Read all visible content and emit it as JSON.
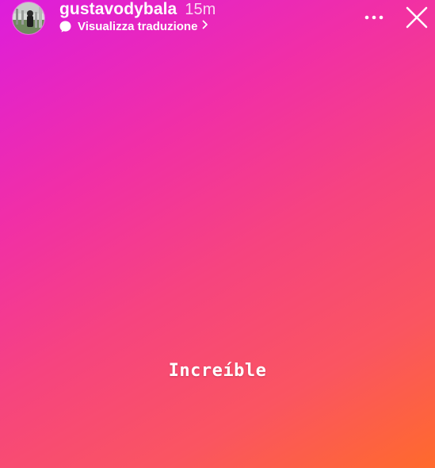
{
  "story": {
    "username": "gustavodybala",
    "time_ago": "15m",
    "translate_label": "Visualizza traduzione",
    "caption": "Increíble",
    "gradient_colors": [
      "#dd1ddc",
      "#f12fa6",
      "#f6447f",
      "#fa5561",
      "#ff6a2c"
    ]
  },
  "icons": {
    "avatar": "avatar",
    "translate": "translate-icon",
    "chevron": "chevron-right-icon",
    "more": "more-dots-icon",
    "close": "close-icon"
  }
}
